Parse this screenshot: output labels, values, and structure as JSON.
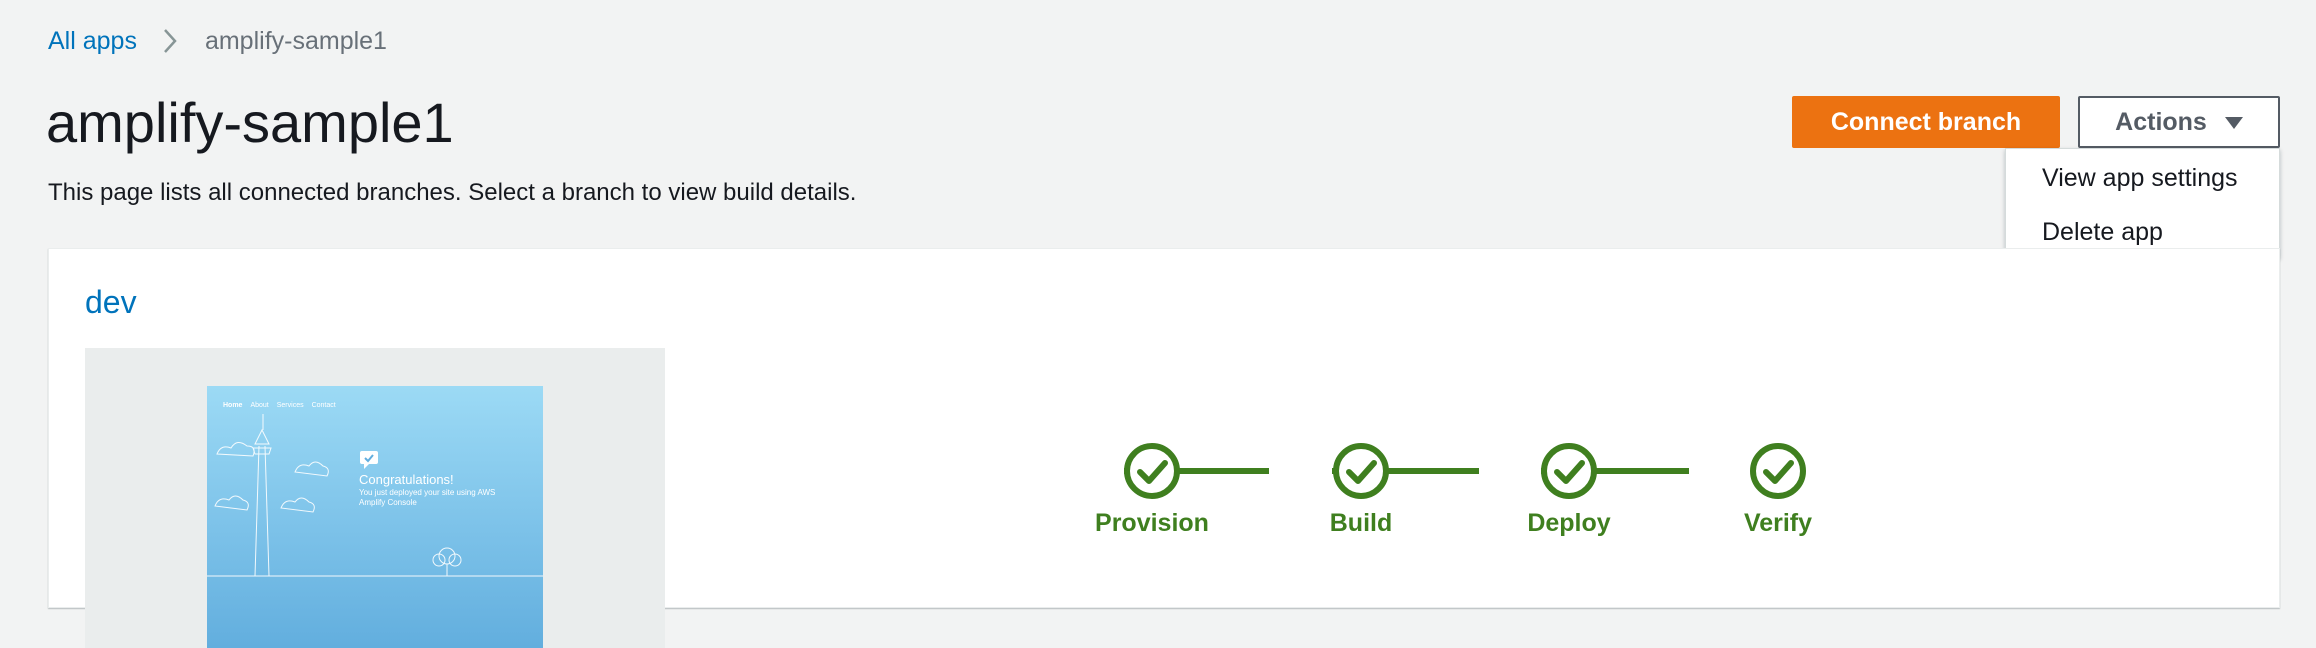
{
  "breadcrumb": {
    "root": "All apps",
    "current": "amplify-sample1"
  },
  "page": {
    "title": "amplify-sample1",
    "description": "This page lists all connected branches. Select a branch to view build details."
  },
  "header_actions": {
    "connect_branch": "Connect branch",
    "actions": "Actions",
    "menu": [
      "View app settings",
      "Delete app"
    ]
  },
  "branch": {
    "name": "dev",
    "preview": {
      "nav": [
        "Home",
        "About",
        "Services",
        "Contact"
      ],
      "heading": "Congratulations!",
      "subtext": "You just deployed your site using AWS Amplify Console"
    },
    "pipeline": {
      "steps": [
        {
          "label": "Provision",
          "status": "success"
        },
        {
          "label": "Build",
          "status": "success"
        },
        {
          "label": "Deploy",
          "status": "success"
        },
        {
          "label": "Verify",
          "status": "success"
        }
      ]
    }
  },
  "colors": {
    "link": "#0073bb",
    "primary": "#ec7211",
    "success": "#3f7f1f",
    "background": "#f2f3f3"
  }
}
